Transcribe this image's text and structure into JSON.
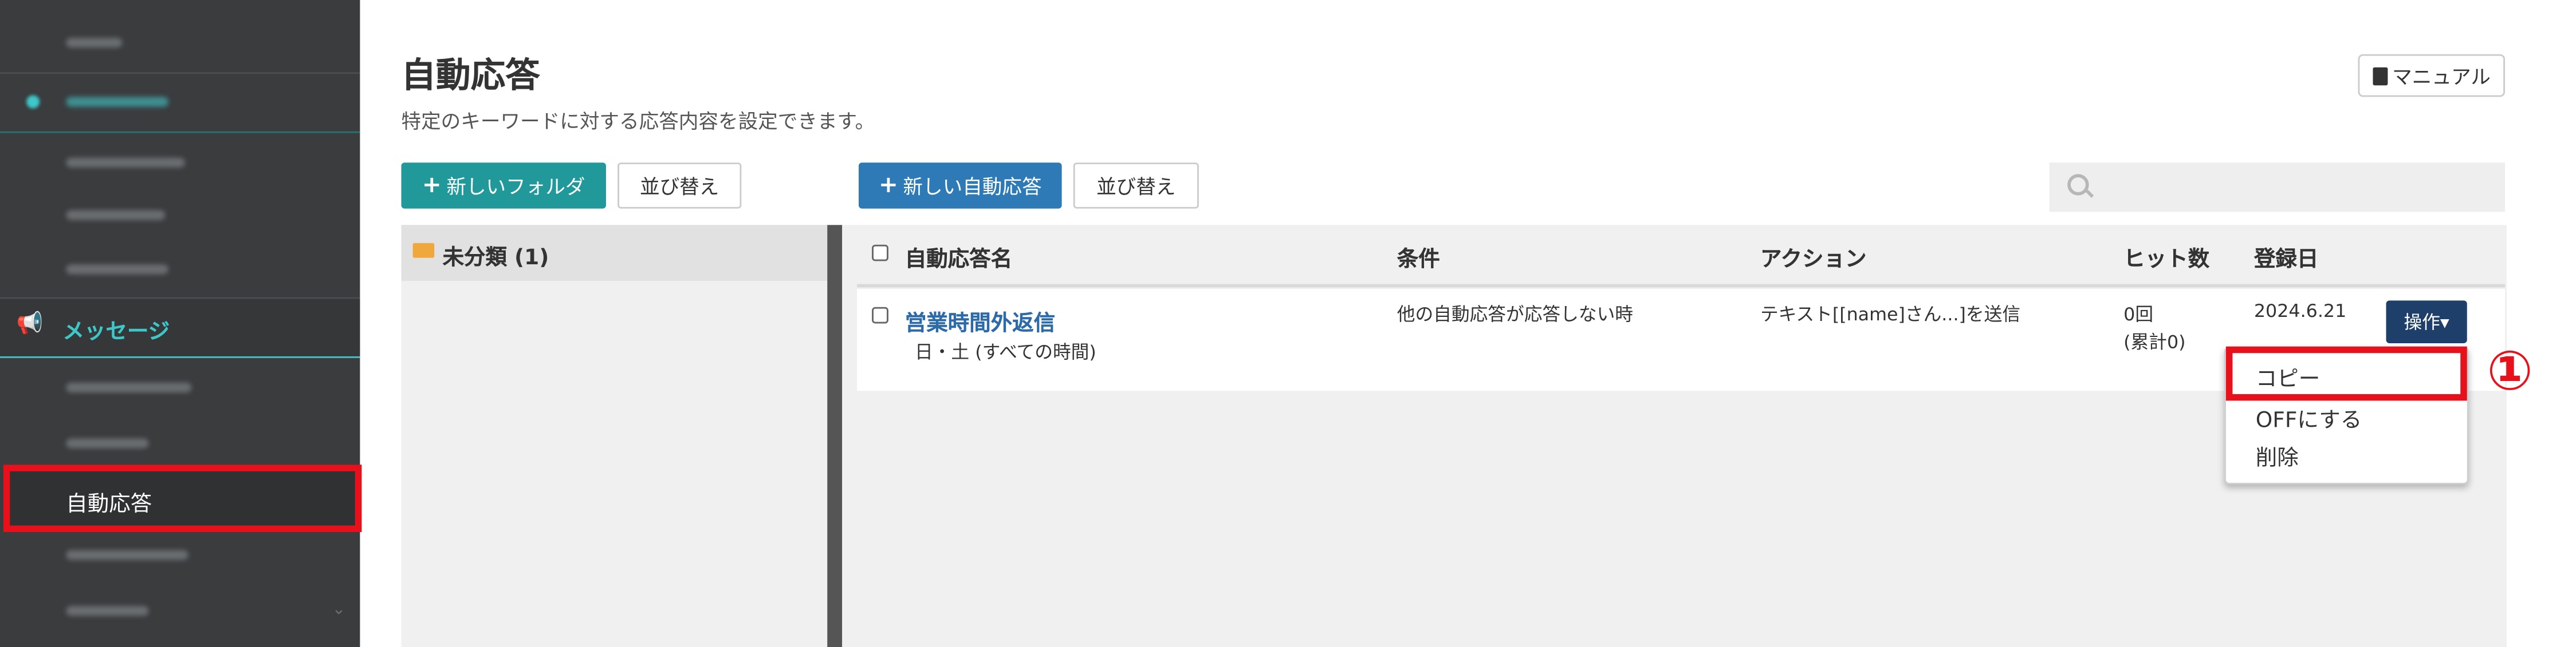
{
  "sidebar": {
    "section_label": "メッセージ",
    "active_item": "自動応答"
  },
  "header": {
    "title": "自動応答",
    "subtitle": "特定のキーワードに対する応答内容を設定できます。",
    "manual_label": "マニュアル"
  },
  "folders": {
    "new_folder_label": "新しいフォルダ",
    "sort_label": "並び替え",
    "items": [
      {
        "label": "未分類 (1)"
      }
    ]
  },
  "responses": {
    "new_label": "新しい自動応答",
    "sort_label": "並び替え",
    "columns": [
      "自動応答名",
      "条件",
      "アクション",
      "ヒット数",
      "登録日"
    ],
    "rows": [
      {
        "name": "営業時間外返信",
        "schedule": "日・土 (すべての時間)",
        "condition": "他の自動応答が応答しない時",
        "action": "テキスト[[name]さん...]を送信",
        "hits": "0回",
        "hits_total": "(累計0)",
        "date": "2024.6.21",
        "ops_label": "操作▾"
      }
    ]
  },
  "ops_menu": {
    "items": [
      "コピー",
      "OFFにする",
      "削除"
    ]
  },
  "annotation": {
    "step": "①"
  },
  "colors": {
    "accent_teal": "#21999a",
    "accent_blue": "#2e7ab6",
    "highlight_red": "#e8101a",
    "sidebar_bg": "#3a3c3e"
  }
}
